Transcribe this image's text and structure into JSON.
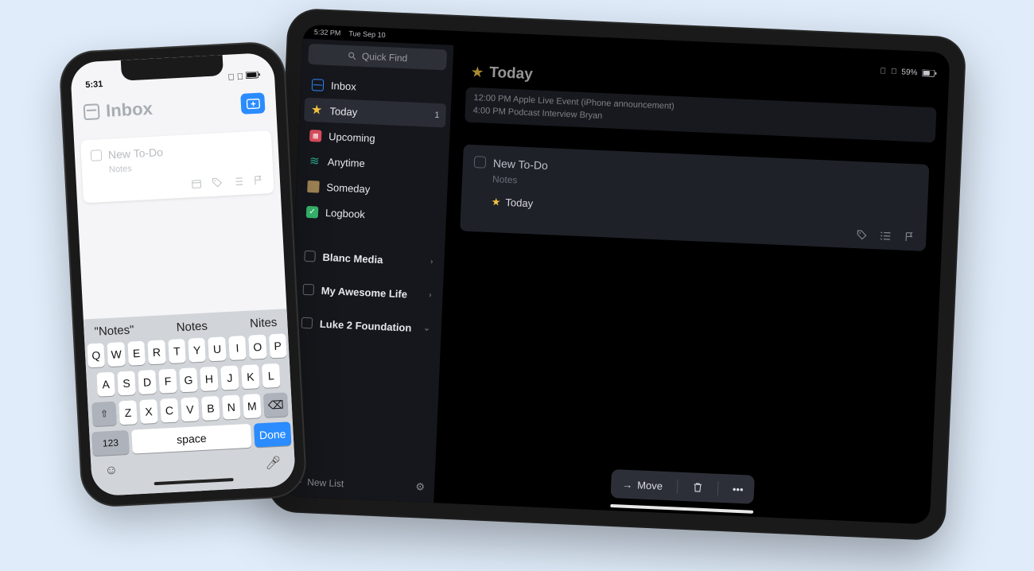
{
  "iphone": {
    "status_time": "5:31",
    "header_title": "Inbox",
    "card": {
      "title": "New To-Do",
      "notes": "Notes"
    },
    "keyboard": {
      "predictions": [
        "\"Notes\"",
        "Notes",
        "Nites"
      ],
      "row1": [
        "Q",
        "W",
        "E",
        "R",
        "T",
        "Y",
        "U",
        "I",
        "O",
        "P"
      ],
      "row2": [
        "A",
        "S",
        "D",
        "F",
        "G",
        "H",
        "J",
        "K",
        "L"
      ],
      "row3": [
        "Z",
        "X",
        "C",
        "V",
        "B",
        "N",
        "M"
      ],
      "num_key": "123",
      "space_key": "space",
      "done_key": "Done"
    }
  },
  "ipad": {
    "sysbar": {
      "time": "5:32 PM",
      "date": "Tue Sep 10"
    },
    "status": {
      "battery": "59%"
    },
    "quick_find": "Quick Find",
    "nav": {
      "inbox": "Inbox",
      "today": "Today",
      "today_badge": "1",
      "upcoming": "Upcoming",
      "anytime": "Anytime",
      "someday": "Someday",
      "logbook": "Logbook"
    },
    "areas": [
      {
        "label": "Blanc Media"
      },
      {
        "label": "My Awesome Life"
      },
      {
        "label": "Luke 2 Foundation"
      }
    ],
    "new_list": "New List",
    "page_title": "Today",
    "events": {
      "line1": "12:00 PM Apple Live Event (iPhone announcement)",
      "line2": "4:00 PM Podcast Interview Bryan"
    },
    "card": {
      "title": "New To-Do",
      "notes": "Notes",
      "tag_label": "Today"
    },
    "toolbar": {
      "move": "Move"
    }
  }
}
